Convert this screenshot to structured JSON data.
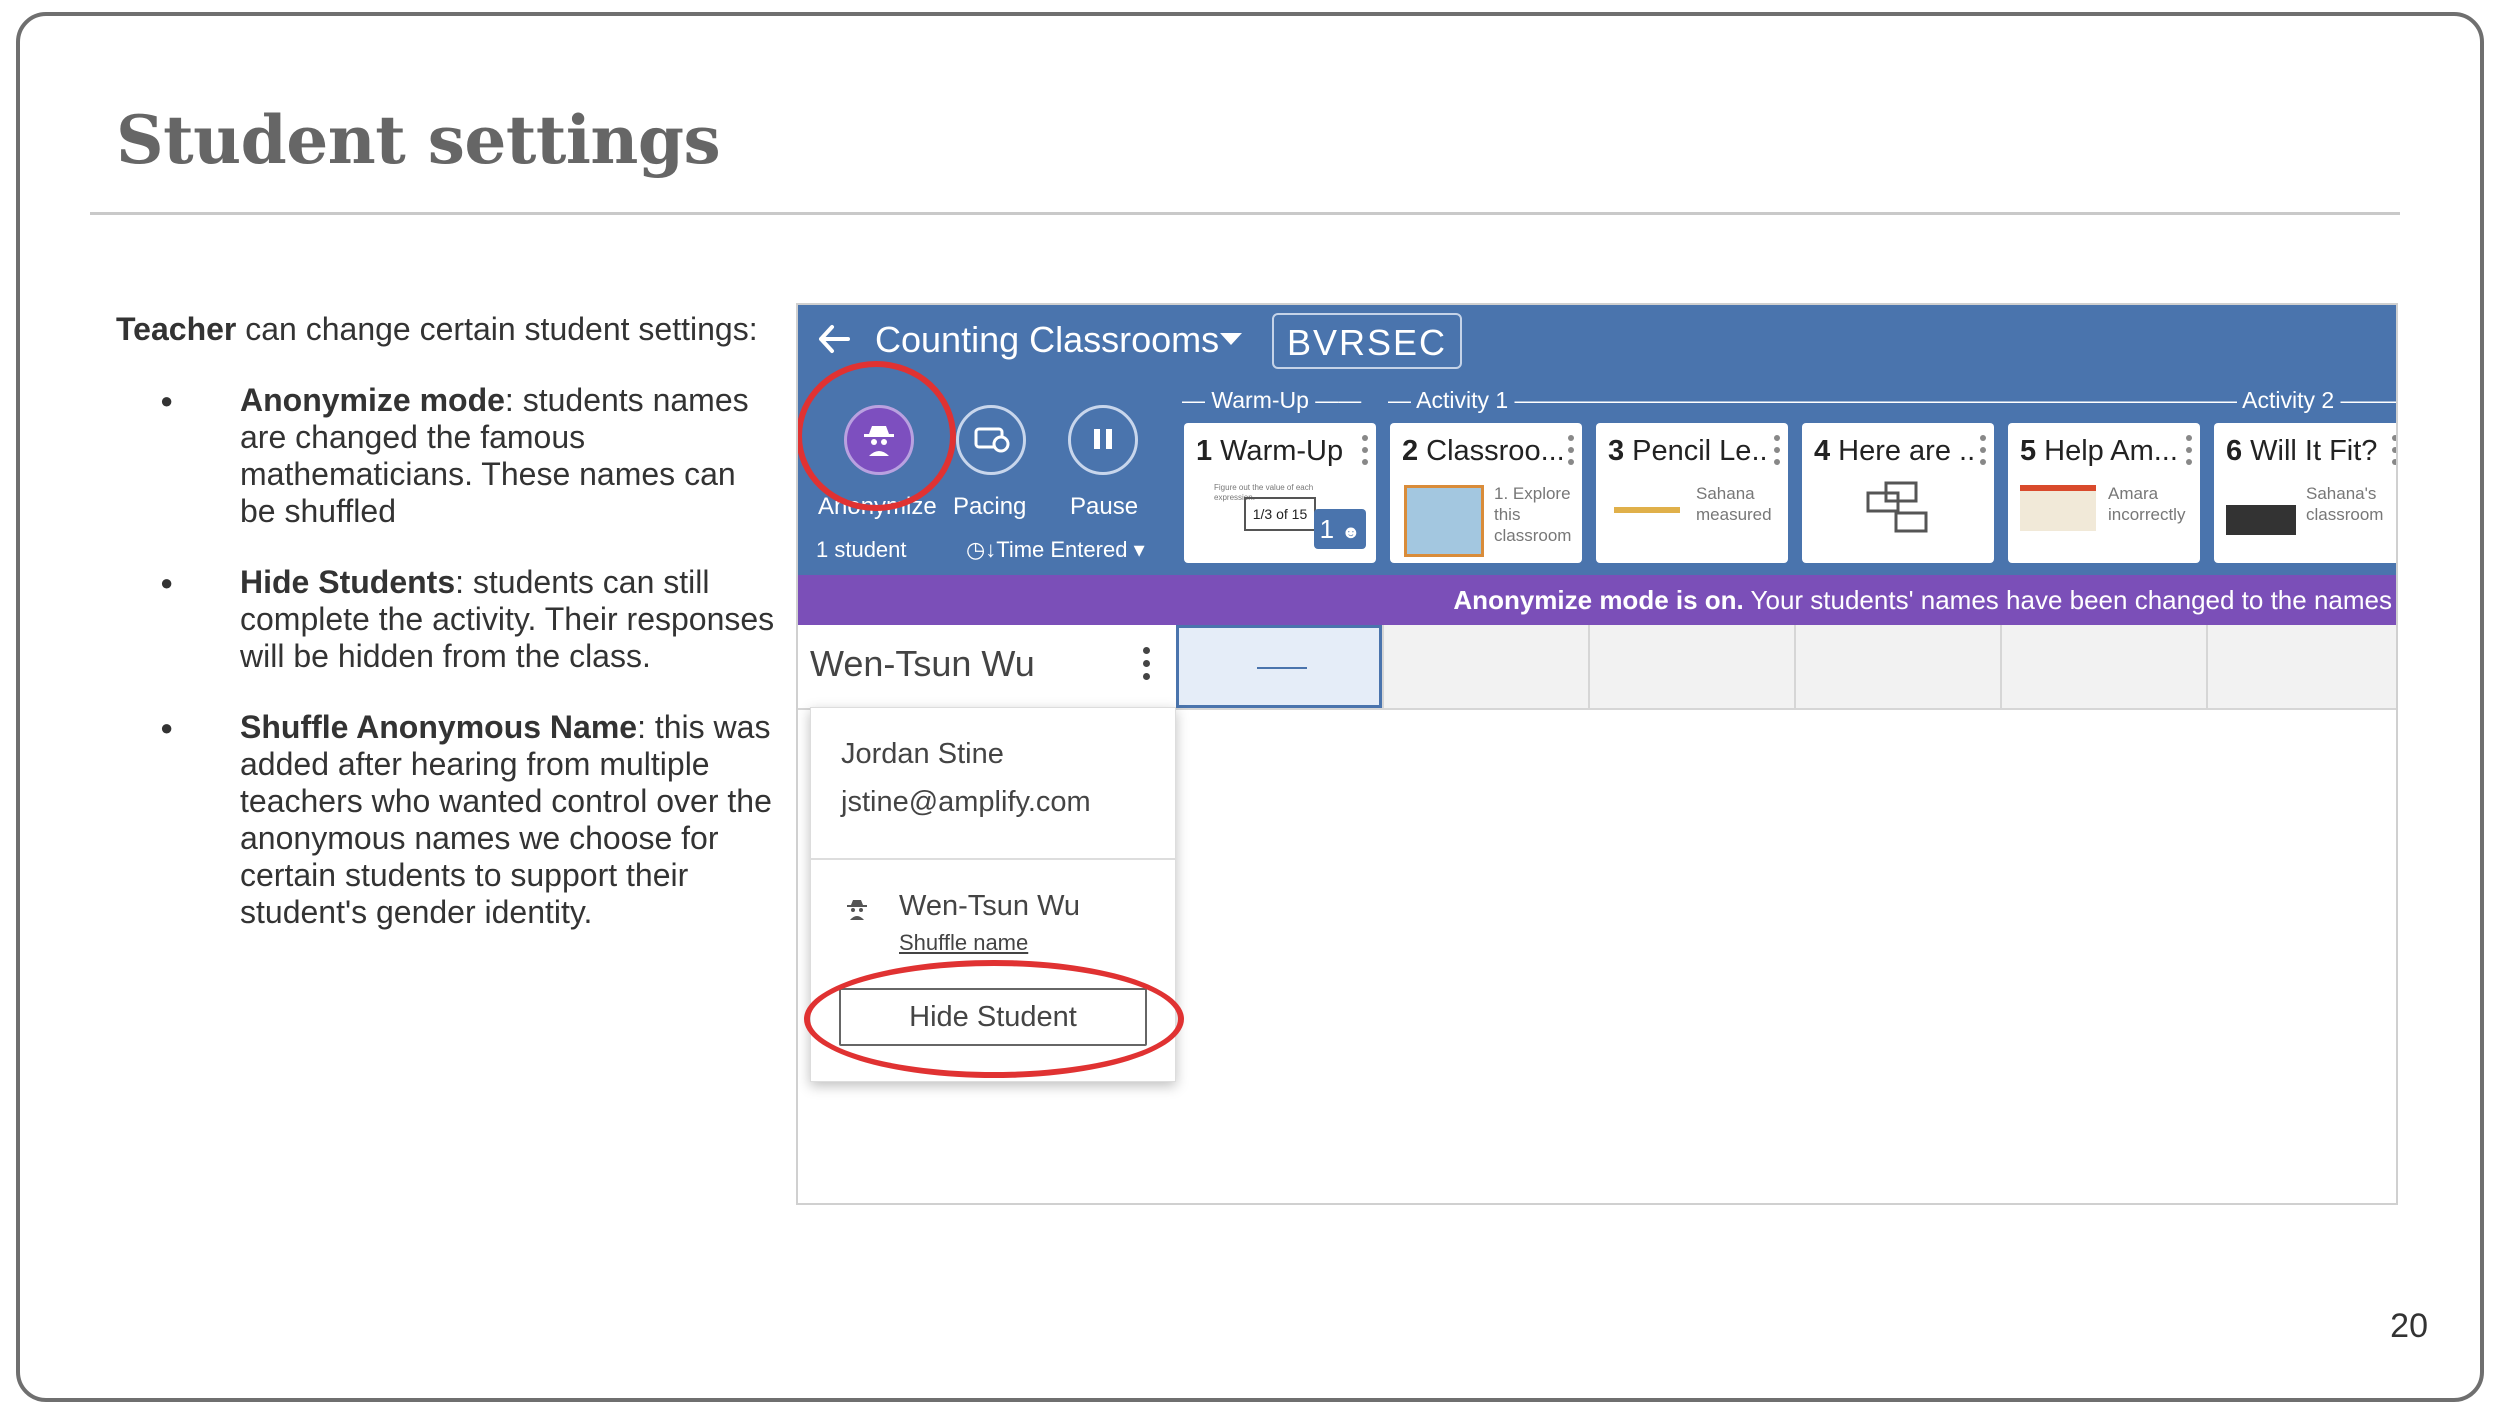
{
  "slide": {
    "title": "Student settings",
    "page_number": "20"
  },
  "text": {
    "intro_bold": "Teacher",
    "intro_rest": " can change certain student settings:",
    "bullets": [
      {
        "bold": "Anonymize mode",
        "rest": ": students names are changed the famous mathematicians. These names can be shuffled"
      },
      {
        "bold": "Hide Students",
        "rest": ": students can still complete the activity. Their responses will be hidden from the class."
      },
      {
        "bold": "Shuffle Anonymous Name",
        "rest": ": this was added after hearing from multiple teachers who wanted control over the anonymous names we choose for certain students to support their student's gender identity."
      }
    ]
  },
  "app": {
    "class_name": "Counting Classrooms",
    "class_code": "BVRSEC",
    "tools": [
      {
        "label": "Anonymize",
        "icon": "spy-icon"
      },
      {
        "label": "Pacing",
        "icon": "pacing-icon"
      },
      {
        "label": "Pause",
        "icon": "pause-icon"
      }
    ],
    "tools_sub": {
      "students": "1 student",
      "sort": "Time Entered"
    },
    "groups": [
      "Warm-Up",
      "Activity 1",
      "Activity 2"
    ],
    "cards": [
      {
        "num": "1",
        "title": "Warm-Up",
        "text": "Figure out the value of each expression.",
        "fraction": "1/3 of 15",
        "badge": "1"
      },
      {
        "num": "2",
        "title": "Classroo...",
        "text": "1. Explore this classroom"
      },
      {
        "num": "3",
        "title": "Pencil Le...",
        "text": "Sahana measured"
      },
      {
        "num": "4",
        "title": "Here are ...",
        "text": ""
      },
      {
        "num": "5",
        "title": "Help Am...",
        "text": "Amara incorrectly"
      },
      {
        "num": "6",
        "title": "Will It Fit?",
        "text": "Sahana's classroom"
      }
    ],
    "banner": {
      "bold": "Anonymize mode is on.",
      "rest": " Your students' names have been changed to the names"
    },
    "student_row": {
      "name": "Wen-Tsun Wu",
      "cell_value": "—"
    },
    "menu": {
      "real_name": "Jordan Stine",
      "email": "jstine@amplify.com",
      "anon_name": "Wen-Tsun Wu",
      "shuffle_label": "Shuffle name",
      "hide_label": "Hide Student"
    }
  },
  "colors": {
    "topbar": "#4a74ad",
    "banner": "#7b4fb8",
    "highlight_ring": "#e03232"
  }
}
